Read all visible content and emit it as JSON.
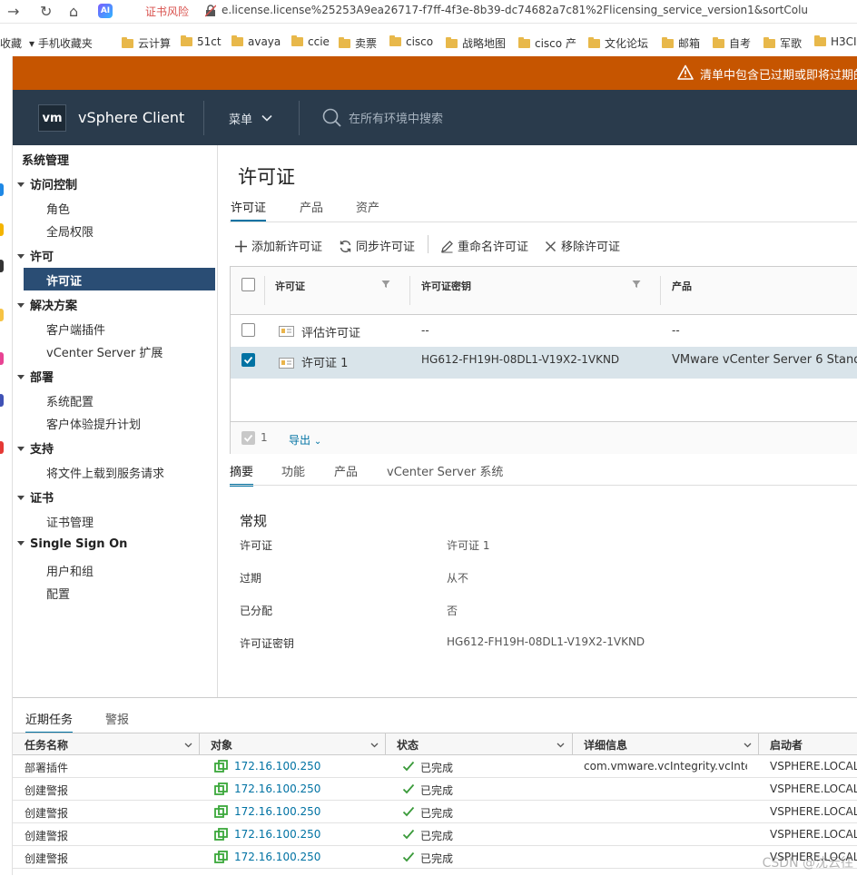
{
  "browser": {
    "cert_risk": "证书风险",
    "url": "e.license.license%25253A9ea26717-f7ff-4f3e-8b39-dc74682a7c81%2Flicensing_service_version1&sortColu",
    "bookmarks": [
      "收藏",
      "手机收藏夹",
      "云计算",
      "51ct",
      "avaya",
      "ccie",
      "卖票",
      "cisco",
      "战略地图",
      "cisco 产",
      "文化论坛",
      "邮箱",
      "自考",
      "军歌",
      "H3CI"
    ]
  },
  "alert": {
    "text": "清单中包含已过期或即将过期的"
  },
  "header": {
    "logo": "vm",
    "app_name": "vSphere Client",
    "menu": "菜单",
    "search_placeholder": "在所有环境中搜索"
  },
  "sidebar": {
    "title": "系统管理",
    "groups": [
      {
        "label": "访问控制",
        "items": [
          "角色",
          "全局权限"
        ]
      },
      {
        "label": "许可",
        "items": [
          "许可证"
        ]
      },
      {
        "label": "解决方案",
        "items": [
          "客户端插件",
          "vCenter Server 扩展"
        ]
      },
      {
        "label": "部署",
        "items": [
          "系统配置",
          "客户体验提升计划"
        ]
      },
      {
        "label": "支持",
        "items": [
          "将文件上载到服务请求"
        ]
      },
      {
        "label": "证书",
        "items": [
          "证书管理"
        ]
      },
      {
        "label": "Single Sign On",
        "items": [
          "用户和组",
          "配置"
        ]
      }
    ],
    "selected": "许可证"
  },
  "main": {
    "title": "许可证",
    "tabs": [
      "许可证",
      "产品",
      "资产"
    ],
    "toolbar": [
      "添加新许可证",
      "同步许可证",
      "重命名许可证",
      "移除许可证"
    ],
    "grid": {
      "columns": [
        "许可证",
        "许可证密钥",
        "产品"
      ],
      "rows": [
        {
          "name": "评估许可证",
          "key": "--",
          "product": "--",
          "checked": false
        },
        {
          "name": "许可证 1",
          "key": "HG612-FH19H-08DL1-V19X2-1VKND",
          "product": "VMware vCenter Server 6 Standa",
          "checked": true
        }
      ],
      "footer_count": "1",
      "export_label": "导出"
    },
    "detail_tabs": [
      "摘要",
      "功能",
      "产品",
      "vCenter Server 系统"
    ],
    "section_title": "常规",
    "details": [
      {
        "label": "许可证",
        "value": "许可证 1"
      },
      {
        "label": "过期",
        "value": "从不"
      },
      {
        "label": "已分配",
        "value": "否"
      },
      {
        "label": "许可证密钥",
        "value": "HG612-FH19H-08DL1-V19X2-1VKND"
      }
    ]
  },
  "tasks": {
    "tabs": [
      "近期任务",
      "警报"
    ],
    "columns": [
      "任务名称",
      "对象",
      "状态",
      "详细信息",
      "启动者"
    ],
    "rows": [
      {
        "name": "部署插件",
        "object": "172.16.100.250",
        "status": "已完成",
        "details": "com.vmware.vcIntegrity.vcInte...",
        "initiator": "VSPHERE.LOCAL"
      },
      {
        "name": "创建警报",
        "object": "172.16.100.250",
        "status": "已完成",
        "details": "",
        "initiator": "VSPHERE.LOCAL"
      },
      {
        "name": "创建警报",
        "object": "172.16.100.250",
        "status": "已完成",
        "details": "",
        "initiator": "VSPHERE.LOCAL"
      },
      {
        "name": "创建警报",
        "object": "172.16.100.250",
        "status": "已完成",
        "details": "",
        "initiator": "VSPHERE.LOCAL"
      },
      {
        "name": "创建警报",
        "object": "172.16.100.250",
        "status": "已完成",
        "details": "",
        "initiator": "VSPHERE.LOCAL"
      }
    ]
  },
  "watermark": "CSDN @沈云往",
  "colors": {
    "alert": "#c65500",
    "header": "#2a3b4c",
    "selected": "#2a4d74",
    "accent": "#0072a3",
    "success": "#3a9a3a"
  }
}
